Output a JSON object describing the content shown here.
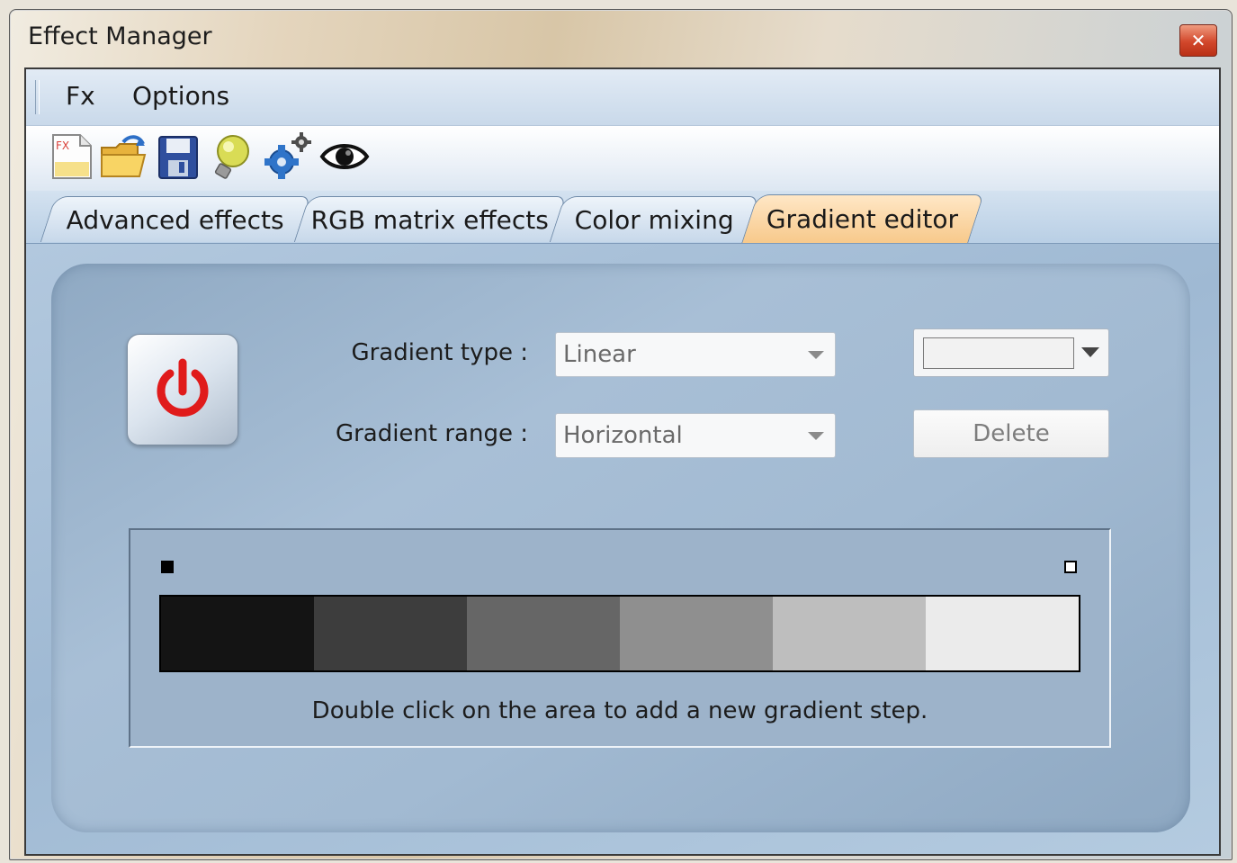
{
  "window": {
    "title": "Effect Manager",
    "close_icon": "close-icon"
  },
  "menu": {
    "items": [
      "Fx",
      "Options"
    ]
  },
  "toolbar": {
    "icons": [
      "new-effect-icon",
      "open-folder-icon",
      "save-icon",
      "lightbulb-icon",
      "settings-gears-icon",
      "preview-eye-icon"
    ]
  },
  "tabs": [
    {
      "label": "Advanced effects",
      "active": false
    },
    {
      "label": "RGB matrix effects",
      "active": false
    },
    {
      "label": "Color mixing",
      "active": false
    },
    {
      "label": "Gradient editor",
      "active": true
    }
  ],
  "gradient": {
    "type_label": "Gradient type :",
    "type_value": "Linear",
    "range_label": "Gradient range :",
    "range_value": "Horizontal",
    "delete_label": "Delete",
    "hint": "Double click on the area to add a new gradient step.",
    "steps": [
      "#141414",
      "#3d3d3d",
      "#666666",
      "#8f8f8f",
      "#bebebe",
      "#ebebeb"
    ],
    "marker_colors": [
      "#000000",
      "#ffffff"
    ]
  }
}
